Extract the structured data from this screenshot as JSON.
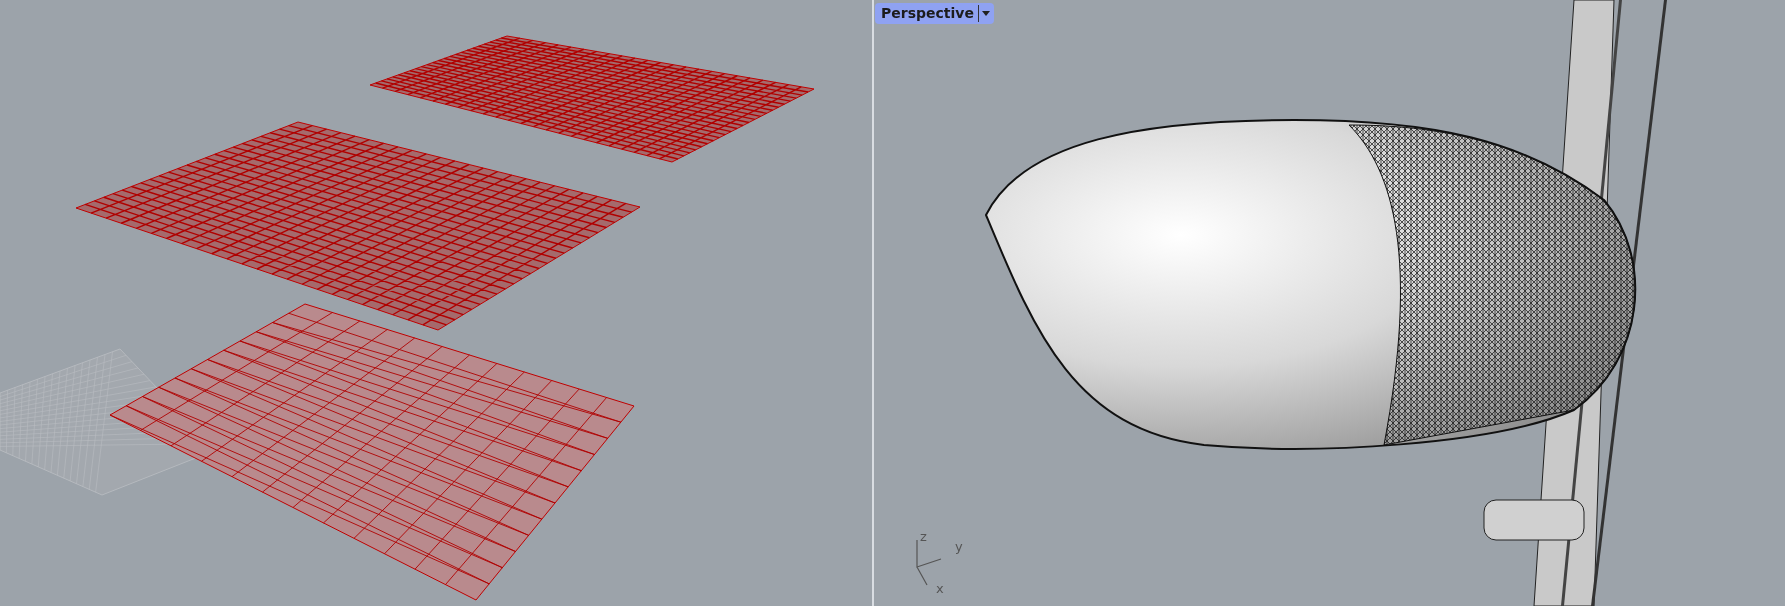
{
  "viewports": [
    {
      "kind": "mesh"
    },
    {
      "kind": "lamp",
      "title": "Perspective",
      "axes": [
        "z",
        "y",
        "x"
      ]
    }
  ]
}
